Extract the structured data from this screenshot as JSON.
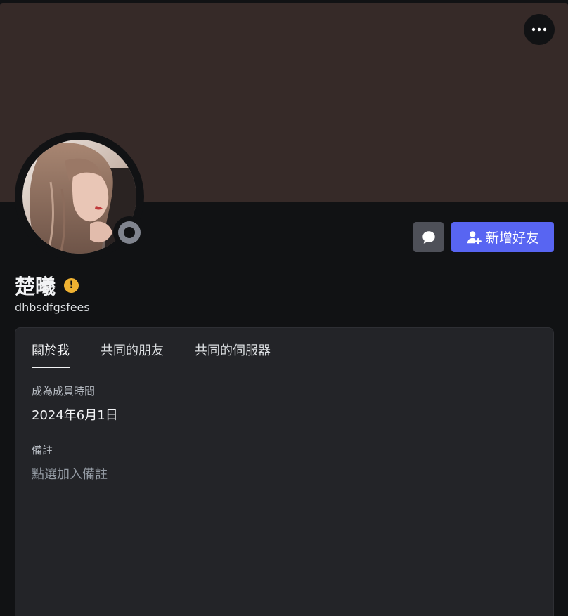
{
  "profile": {
    "display_name": "楚曦",
    "username": "dhbsdfgsfees",
    "banner_color": "#362a28",
    "status": "offline"
  },
  "actions": {
    "more_icon": "more-horizontal-icon",
    "message_icon": "chat-bubble-icon",
    "add_friend_icon": "add-friend-icon",
    "add_friend_label": "新增好友"
  },
  "tabs": [
    {
      "label": "關於我",
      "active": true
    },
    {
      "label": "共同的朋友",
      "active": false
    },
    {
      "label": "共同的伺服器",
      "active": false
    }
  ],
  "about": {
    "member_since_label": "成為成員時間",
    "member_since_value": "2024年6月1日",
    "note_label": "備註",
    "note_placeholder": "點選加入備註"
  },
  "colors": {
    "accent": "#5865f2",
    "warning": "#f0b232",
    "background": "#111214",
    "panel": "#232428"
  }
}
